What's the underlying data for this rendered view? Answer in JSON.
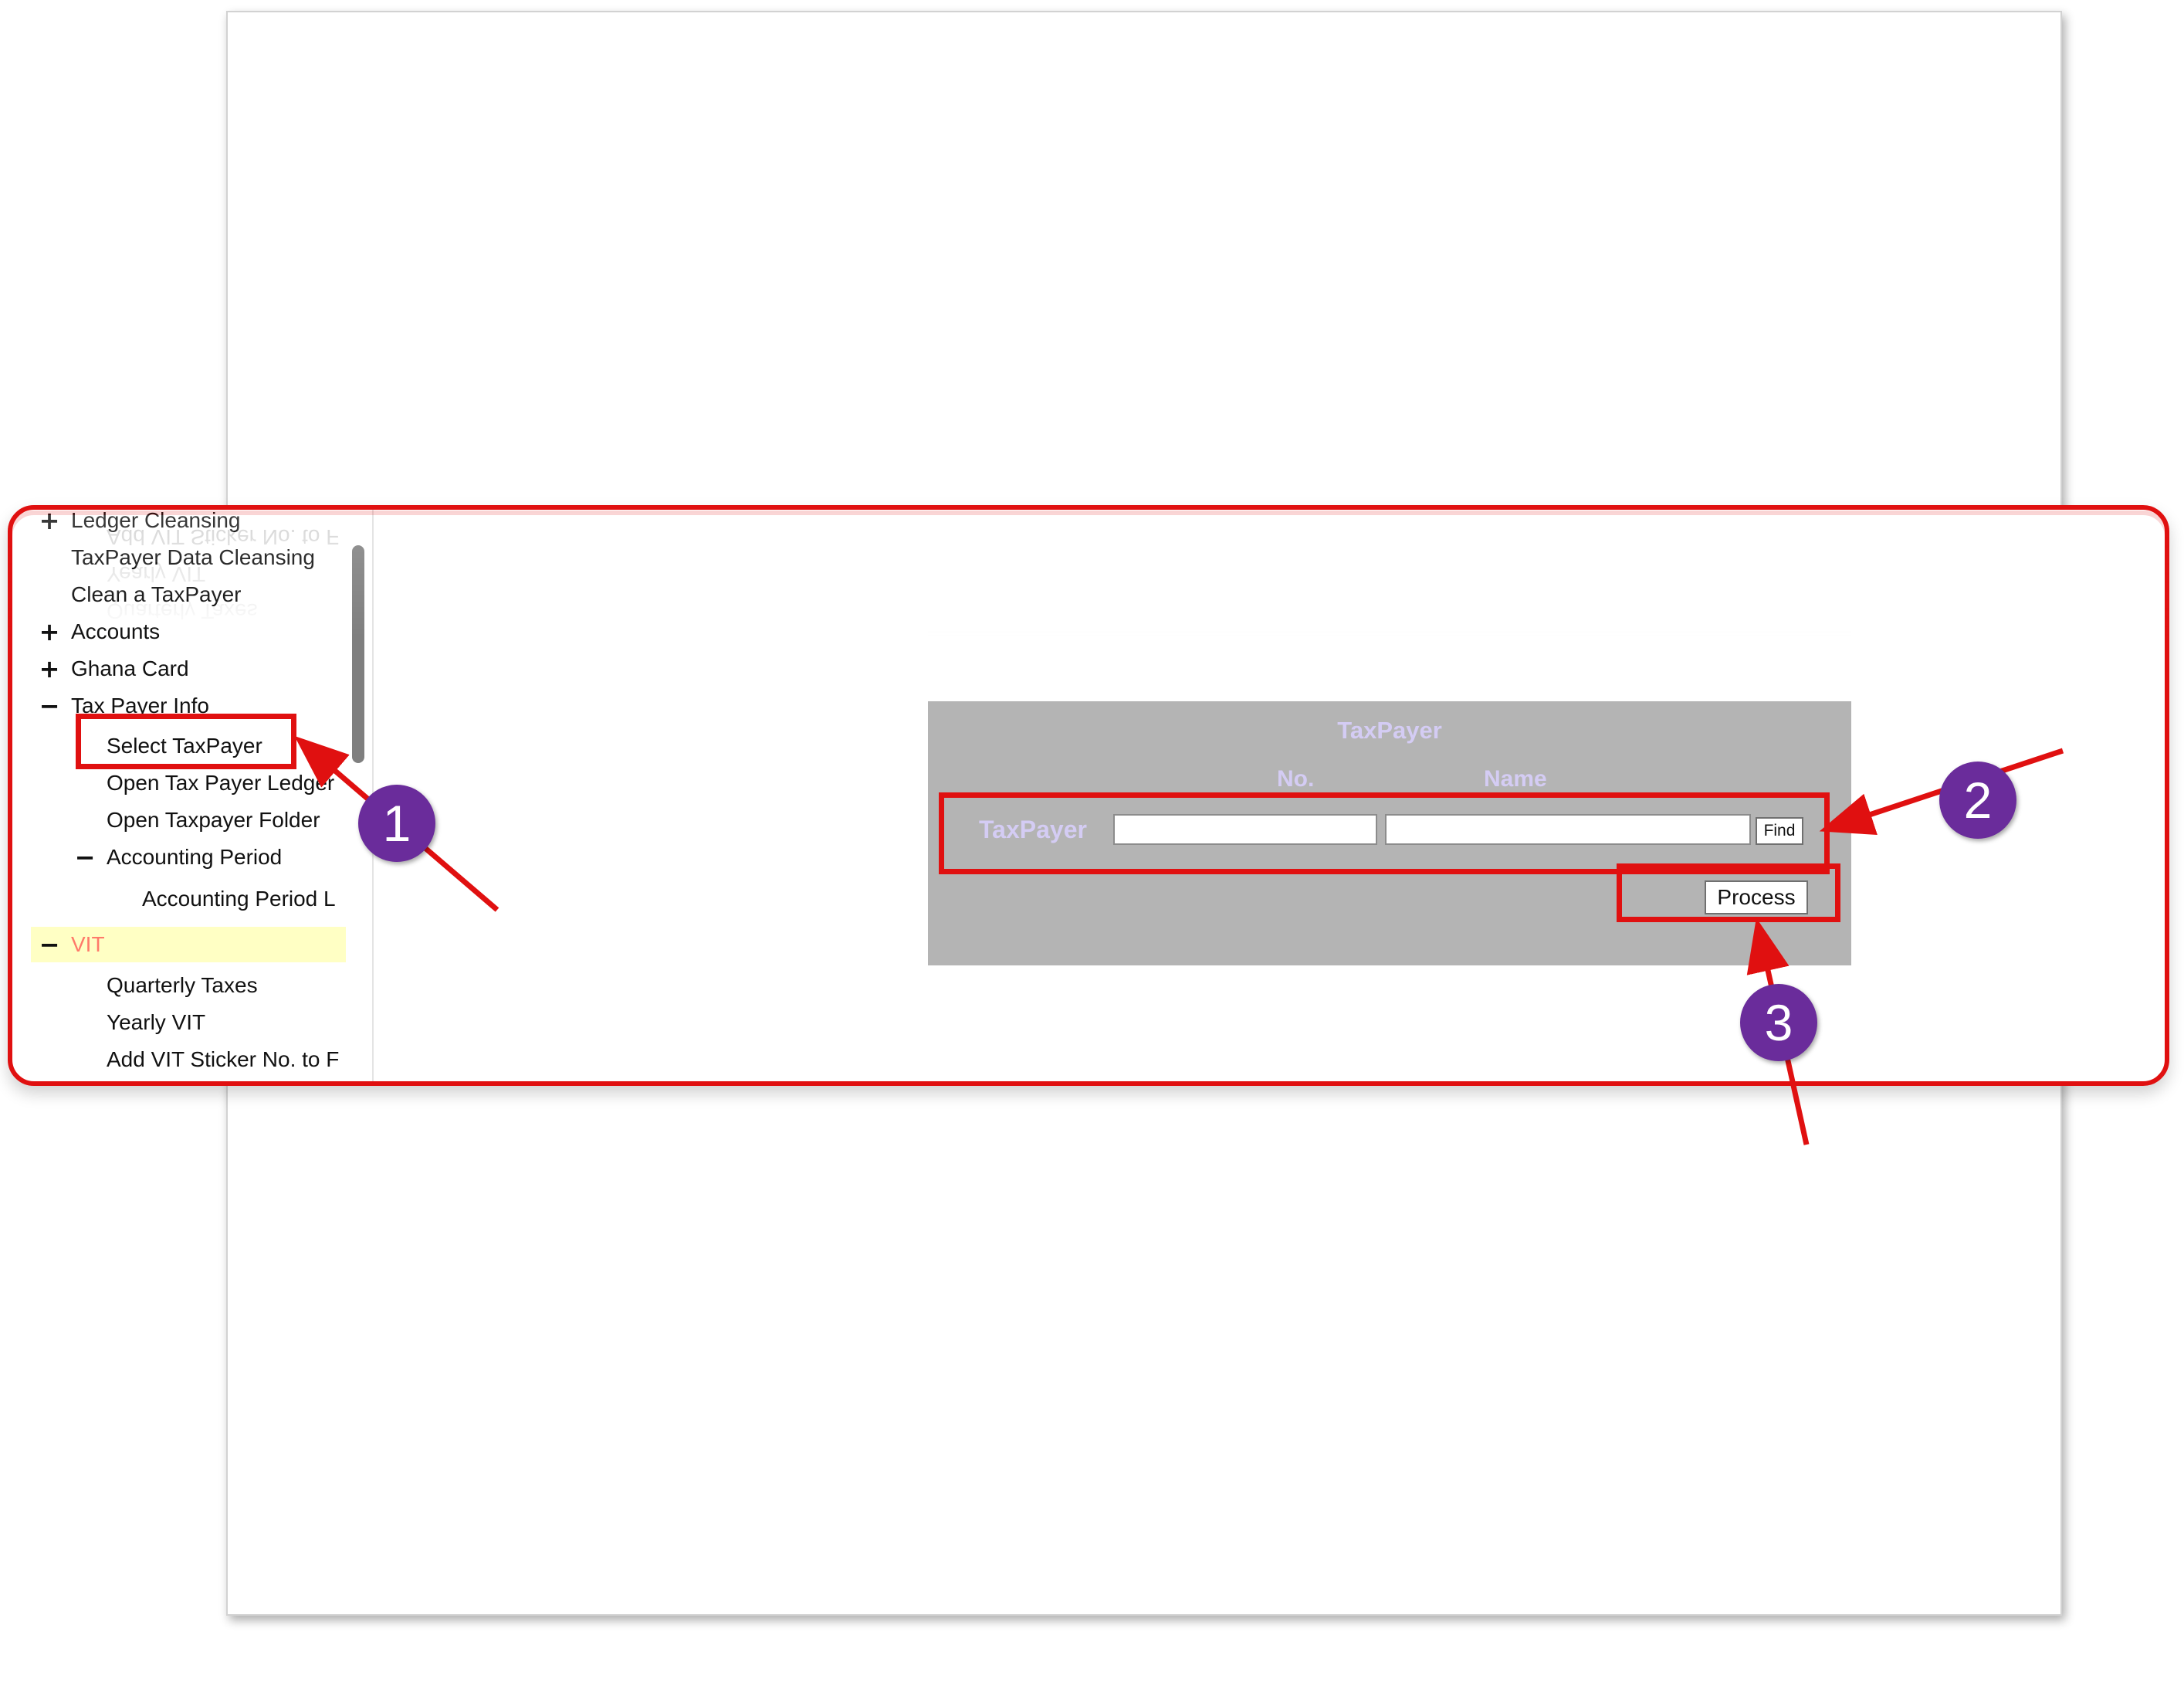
{
  "tree": {
    "items": [
      {
        "label": "Ledger Cleansing",
        "sign": "+"
      },
      {
        "label": "TaxPayer Data Cleansing",
        "sign": ""
      },
      {
        "label": "Clean a TaxPayer",
        "sign": ""
      },
      {
        "label": "Accounts",
        "sign": "+"
      },
      {
        "label": "Ghana Card",
        "sign": "+"
      },
      {
        "label": "Tax Payer Info",
        "sign": "−"
      },
      {
        "label": "Select TaxPayer",
        "sign": ""
      },
      {
        "label": "Open Tax Payer Ledger",
        "sign": ""
      },
      {
        "label": "Open Taxpayer Folder",
        "sign": ""
      },
      {
        "label": "Accounting Period",
        "sign": "−"
      },
      {
        "label": "Accounting Period L",
        "sign": ""
      },
      {
        "label": "VIT",
        "sign": "−"
      },
      {
        "label": "Quarterly Taxes",
        "sign": ""
      },
      {
        "label": "Yearly VIT",
        "sign": ""
      },
      {
        "label": "Add VIT Sticker No. to F",
        "sign": ""
      }
    ]
  },
  "form": {
    "title": "TaxPayer",
    "col_no": "No.",
    "col_name": "Name",
    "row_label": "TaxPayer",
    "no_value": "",
    "name_value": "",
    "find_label": "Find",
    "process_label": "Process"
  },
  "annotations": {
    "step1": "1",
    "step2": "2",
    "step3": "3"
  },
  "colors": {
    "highlight_red": "#e01010",
    "badge_purple": "#6a2c9b",
    "form_bg": "#b4b4b4",
    "form_label": "#d4ccf4",
    "selected_bg": "#ffffc4",
    "selected_text": "#ff7a6a"
  },
  "icons": {
    "expand": "plus-icon",
    "collapse": "minus-icon"
  }
}
